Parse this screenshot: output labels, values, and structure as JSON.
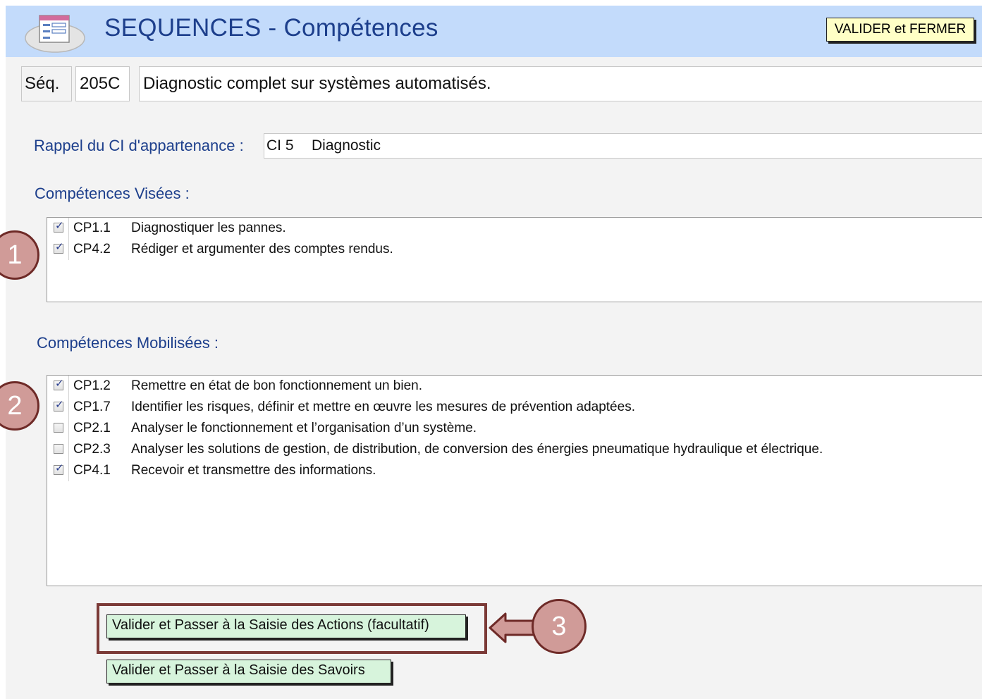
{
  "header": {
    "title": "SEQUENCES - Compétences",
    "validate_close_label": "VALIDER et FERMER"
  },
  "sequence": {
    "label": "Séq.",
    "code": "205C",
    "title": "Diagnostic complet sur systèmes automatisés."
  },
  "ci": {
    "label": "Rappel du CI d'appartenance :",
    "code": "CI 5",
    "name": "Diagnostic"
  },
  "competences_visees": {
    "label": "Compétences Visées :",
    "items": [
      {
        "checked": true,
        "code": "CP1.1",
        "description": "Diagnostiquer les pannes."
      },
      {
        "checked": true,
        "code": "CP4.2",
        "description": "Rédiger et argumenter des comptes rendus."
      }
    ]
  },
  "competences_mobilisees": {
    "label": "Compétences Mobilisées :",
    "items": [
      {
        "checked": true,
        "code": "CP1.2",
        "description": "Remettre en état de bon fonctionnement un bien."
      },
      {
        "checked": true,
        "code": "CP1.7",
        "description": "Identifier les risques, définir et mettre en œuvre les mesures de prévention adaptées."
      },
      {
        "checked": false,
        "code": "CP2.1",
        "description": "Analyser le fonctionnement et l’organisation d’un système."
      },
      {
        "checked": false,
        "code": "CP2.3",
        "description": "Analyser les solutions de gestion, de distribution, de conversion des énergies pneumatique hydraulique et électrique."
      },
      {
        "checked": true,
        "code": "CP4.1",
        "description": "Recevoir et transmettre des informations."
      }
    ]
  },
  "buttons": {
    "actions_label": "Valider et Passer à la Saisie des Actions (facultatif)",
    "savoirs_label": "Valider et Passer à la Saisie des Savoirs"
  },
  "callouts": [
    "1",
    "2",
    "3"
  ],
  "colors": {
    "header_bg": "#c3dbfb",
    "title_text": "#1d3f8c",
    "callout_fill": "#d09b98",
    "callout_border": "#6e2a27",
    "green_button": "#d7f4dc",
    "yellow_button": "#ffffc6"
  }
}
